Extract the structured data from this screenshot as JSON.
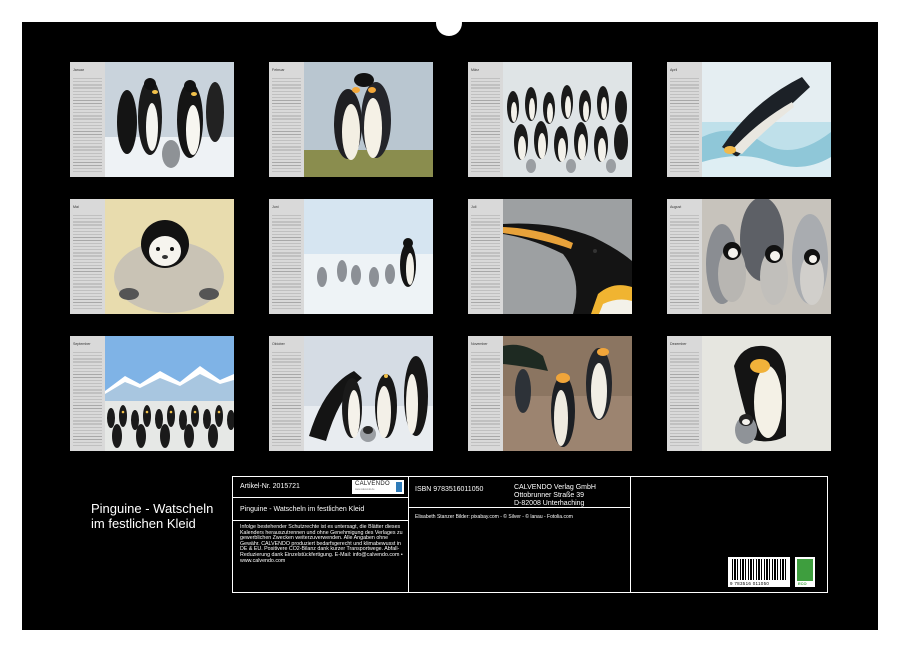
{
  "calendar": {
    "title_line1": "Pinguine - Watscheln",
    "title_line2": "im festlichen Kleid",
    "months": [
      {
        "name": "Januar",
        "photo_icon": "emperor-penguin-group-icon"
      },
      {
        "name": "Februar",
        "photo_icon": "king-penguin-pair-icon"
      },
      {
        "name": "März",
        "photo_icon": "emperor-penguin-colony-icon"
      },
      {
        "name": "April",
        "photo_icon": "penguin-sliding-ice-icon"
      },
      {
        "name": "Mai",
        "photo_icon": "penguin-chick-icon"
      },
      {
        "name": "Juni",
        "photo_icon": "penguin-family-walk-icon"
      },
      {
        "name": "Juli",
        "photo_icon": "king-penguin-head-icon"
      },
      {
        "name": "August",
        "photo_icon": "penguin-chicks-icon"
      },
      {
        "name": "September",
        "photo_icon": "colony-mountains-icon"
      },
      {
        "name": "Oktober",
        "photo_icon": "adult-penguins-chick-icon"
      },
      {
        "name": "November",
        "photo_icon": "king-penguins-beach-icon"
      },
      {
        "name": "Dezember",
        "photo_icon": "penguin-parent-chick-icon"
      }
    ]
  },
  "info": {
    "article_label": "Artikel-Nr. 2015721",
    "logo_text": "CALVENDO",
    "logo_sub": "www.calvendo.de",
    "product_title": "Pinguine - Watscheln im festlichen Kleid",
    "legal_text": "Infolge bestehender Schutzrechte ist es untersagt, die Blätter dieses Kalenders herauszutrennen und ohne Genehmigung des Verlages zu gewerblichen Zwecken weiterzuverwenden. Alle Angaben ohne Gewähr. CALVENDO produziert bedarfsgerecht und klimabewusst in DE & EU. Positivere CO2-Bilanz dank kurzer Transportwege. Abfall-Reduzierung dank Einzelstückfertigung. E-Mail: info@calvendo.com • www.calvendo.com",
    "isbn": "ISBN 9783516011050",
    "publisher_line1": "CALVENDO Verlag GmbH",
    "publisher_line2": "Ottobrunner Straße 39",
    "publisher_line3": "D-82008 Unterhaching",
    "credits": "Elisabeth Stanzer Bilder: pixabay.com - © Silver - © lanau - Fotolia.com",
    "barcode_number": "9 783516 011050",
    "eco_label": "ECO"
  },
  "colors": {
    "background": "#000000",
    "page": "#ffffff",
    "calendar_strip": "#d9d9d9"
  }
}
